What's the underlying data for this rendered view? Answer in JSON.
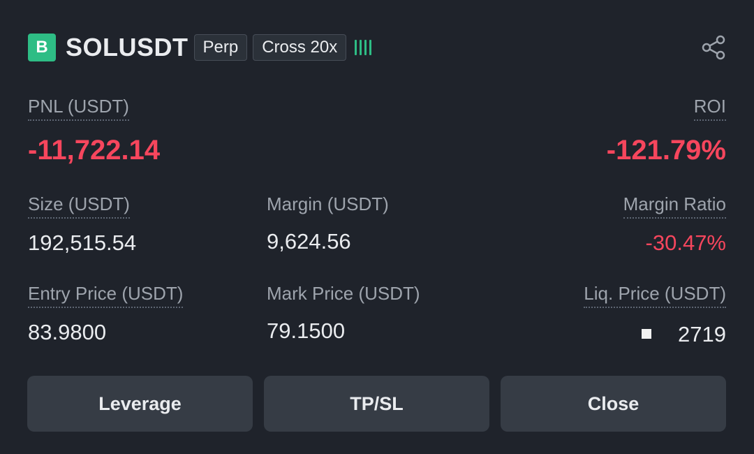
{
  "header": {
    "side_badge": "B",
    "symbol": "SOLUSDT",
    "tags": [
      "Perp",
      "Cross 20x"
    ]
  },
  "icons": {
    "share": "share-icon",
    "risk": "risk-bars-icon"
  },
  "colors": {
    "positive": "#2ebd85",
    "negative": "#f6465d",
    "background": "#1f232b",
    "button": "#363c45"
  },
  "pnl": {
    "label": "PNL (USDT)",
    "value": "-11,722.14"
  },
  "roi": {
    "label": "ROI",
    "value": "-121.79%"
  },
  "size": {
    "label": "Size (USDT)",
    "value": "192,515.54"
  },
  "margin": {
    "label": "Margin (USDT)",
    "value": "9,624.56"
  },
  "margin_ratio": {
    "label": "Margin Ratio",
    "value": "-30.47%"
  },
  "entry_price": {
    "label": "Entry Price (USDT)",
    "value": "83.9800"
  },
  "mark_price": {
    "label": "Mark Price (USDT)",
    "value": "79.1500"
  },
  "liq_price": {
    "label": "Liq. Price (USDT)",
    "value": "2719"
  },
  "buttons": {
    "leverage": "Leverage",
    "tpsl": "TP/SL",
    "close": "Close"
  }
}
